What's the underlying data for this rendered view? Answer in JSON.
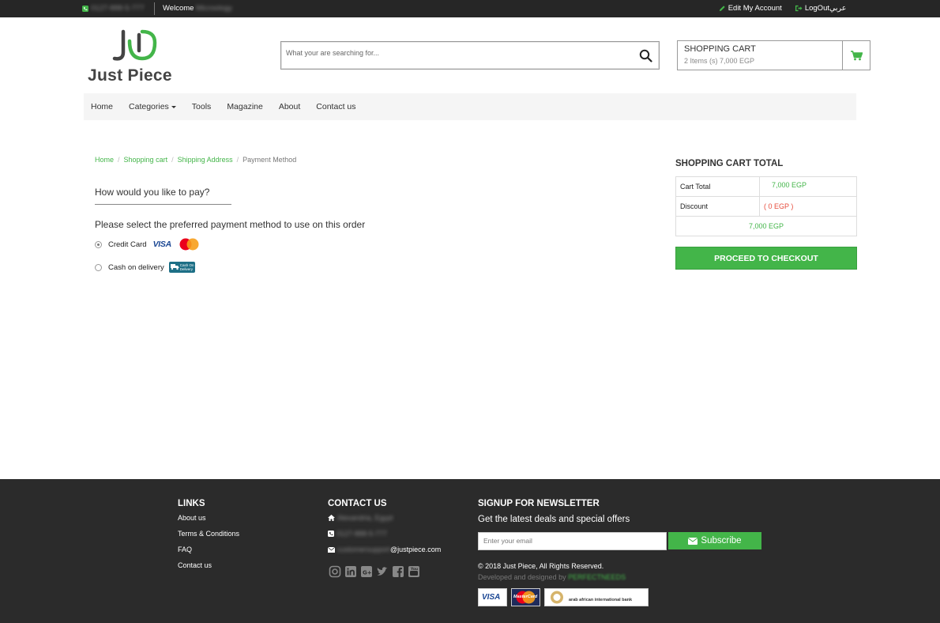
{
  "topbar": {
    "phone": "0127-888-5-777",
    "welcome_label": "Welcome",
    "user_name": "Microology",
    "edit_account": "Edit My Account",
    "logout": "LogOut",
    "language": "عربي"
  },
  "logo": {
    "text": "Just Piece"
  },
  "search": {
    "placeholder": "What your are searching for..."
  },
  "cart": {
    "title": "SHOPPING CART",
    "summary": "2 Items (s) 7,000 EGP"
  },
  "nav": {
    "items": [
      "Home",
      "Categories",
      "Tools",
      "Magazine",
      "About",
      "Contact us"
    ]
  },
  "breadcrumb": {
    "items": [
      "Home",
      "Shopping cart",
      "Shipping Address",
      "Payment Method"
    ]
  },
  "payment": {
    "question": "How would you like to pay?",
    "instruction": "Please select the preferred payment method to use on this order",
    "options": [
      {
        "label": "Credit Card",
        "selected": true,
        "badge": "VISA",
        "badge2": "MasterCard"
      },
      {
        "label": "Cash on delivery",
        "selected": false,
        "badge": "Cash On Delivery"
      }
    ]
  },
  "cart_total": {
    "title": "SHOPPING CART TOTAL",
    "rows": [
      {
        "label": "Cart Total",
        "value": "7,000 EGP"
      },
      {
        "label": "Discount",
        "value": "( 0 EGP )"
      }
    ],
    "total": "7,000 EGP",
    "checkout": "PROCEED TO CHECKOUT"
  },
  "footer": {
    "links_title": "LINKS",
    "links": [
      "About us",
      "Terms & Conditions",
      "FAQ",
      "Contact us"
    ],
    "contact_title": "CONTACT US",
    "address": "Alexandria, Egypt",
    "phone": "0127-888-5-777",
    "email_user": "customersupport",
    "email_domain": "@justpiece.com",
    "newsletter_title": "SIGNUP FOR NEWSLETTER",
    "newsletter_sub": "Get the latest deals and special offers",
    "email_placeholder": "Enter your email",
    "subscribe": "Subscribe",
    "copyright": "© 2018 Just Piece, All Rights Reserved.",
    "developed_by": "Developed and designed by",
    "developer": "PERFECTNEEDS",
    "payment_logos": [
      "VISA",
      "MasterCard",
      "arab african international bank"
    ]
  },
  "colors": {
    "accent": "#43b549",
    "dark": "#262626",
    "discount": "#e74c3c"
  }
}
